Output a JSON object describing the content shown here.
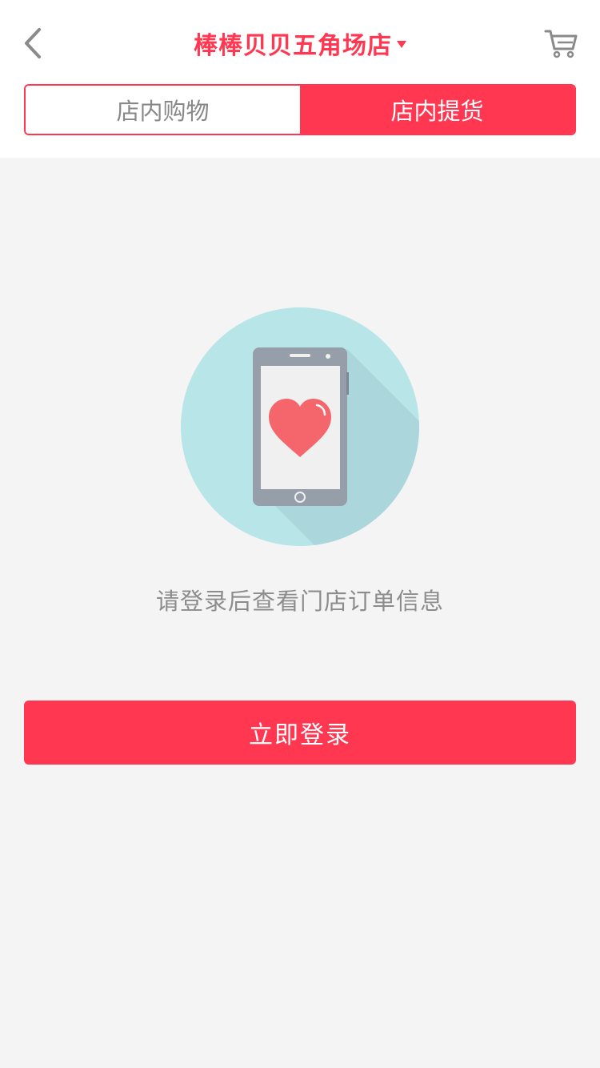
{
  "header": {
    "store_name": "棒棒贝贝五角场店",
    "back_icon": "chevron-left-icon",
    "cart_icon": "shopping-cart-icon",
    "dropdown_icon": "caret-down-icon"
  },
  "tabs": [
    {
      "label": "店内购物",
      "active": false
    },
    {
      "label": "店内提货",
      "active": true
    }
  ],
  "empty_state": {
    "illustration": "phone-heart-illustration",
    "message": "请登录后查看门店订单信息"
  },
  "login_button": {
    "label": "立即登录"
  },
  "colors": {
    "accent": "#ff3750",
    "background": "#f4f4f4",
    "circle": "#b7e5e8",
    "phone_body": "#959ea9",
    "heart": "#f4656c"
  }
}
